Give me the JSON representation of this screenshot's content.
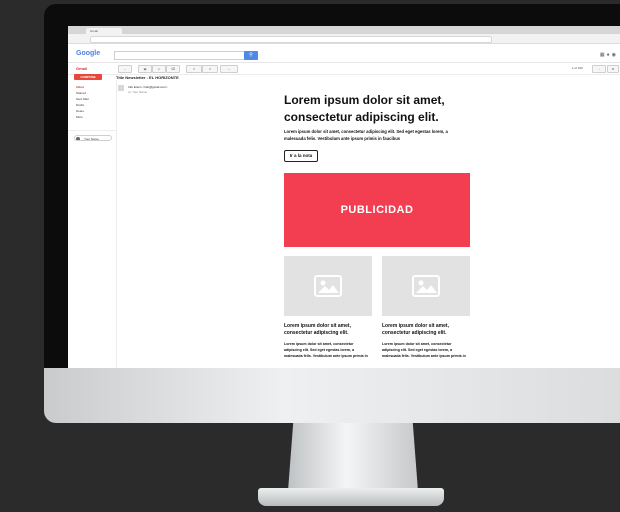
{
  "browser": {
    "tab_label": "Gmail",
    "google_logo": "Google"
  },
  "gmail": {
    "label": "Gmail",
    "compose_label": "COMPOSE",
    "subject": "Title Newsletter - EL HORIZONTE",
    "sidebar_items": [
      "Inbox",
      "Starred",
      "Sent Mail",
      "Drafts",
      "Notes",
      "More"
    ],
    "chat_user": "Your Name",
    "pager": "1 of 100"
  },
  "email": {
    "sender": "Info Enum <info@gmail.com>",
    "to": "to: Your Name"
  },
  "newsletter": {
    "title": "Lorem ipsum dolor sit amet, consectetur adipiscing elit.",
    "body": "Lorem ipsum dolor sit amet, consectetur adipiscing elit. Sed eget egestas lorem, a malesuada felis. Vestibulum ante ipsum primis in faucibus",
    "button_label": "Ir a la nota",
    "ad_label": "PUBLICIDAD",
    "cards": [
      {
        "title": "Lorem ipsum dolor sit amet, consectetur adipiscing elit.",
        "body": "Lorem ipsum dolor sit amet, consectetur adipiscing elit. Sed eget egestas lorem, a malesuada felis. Vestibulum ante ipsum primis in"
      },
      {
        "title": "Lorem ipsum dolor sit amet, consectetur adipiscing elit.",
        "body": "Lorem ipsum dolor sit amet, consectetur adipiscing elit. Sed eget egestas lorem, a malesuada felis. Vestibulum ante ipsum primis in"
      }
    ]
  },
  "colors": {
    "ad_background": "#f33e52",
    "background": "#2b2b2b",
    "compose": "#e8473a",
    "search_button": "#4d8ae8"
  },
  "icons": {
    "placeholder": "image-placeholder-icon",
    "search": "search-icon"
  }
}
